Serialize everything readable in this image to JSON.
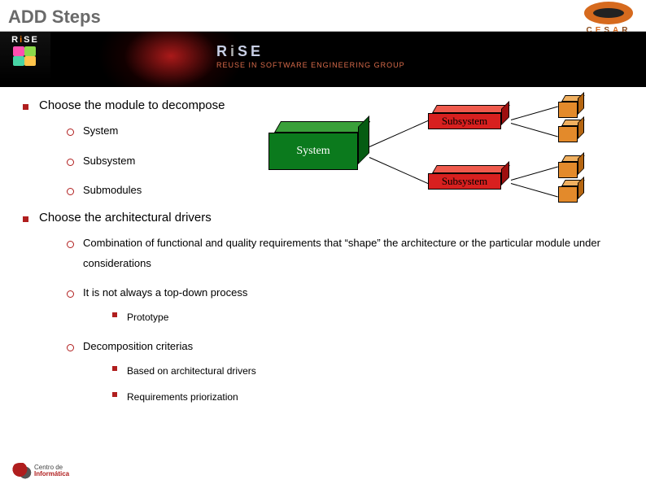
{
  "title": "ADD Steps",
  "brand": {
    "rise": "RiSE",
    "band_heading": "RiSE",
    "band_tagline": "REUSE IN SOFTWARE ENGINEERING GROUP",
    "right_logo": "CESAR"
  },
  "bullets": [
    {
      "text": "Choose the module to decompose",
      "children": [
        {
          "text": "System"
        },
        {
          "text": "Subsystem"
        },
        {
          "text": "Submodules"
        }
      ]
    },
    {
      "text": "Choose the architectural drivers",
      "children": [
        {
          "text": "Combination of functional and quality requirements that “shape” the architecture or the particular module under considerations"
        },
        {
          "text": "It is not always a top-down process",
          "children": [
            {
              "text": "Prototype"
            }
          ]
        },
        {
          "text": "Decomposition criterias",
          "children": [
            {
              "text": "Based on architectural drivers"
            },
            {
              "text": "Requirements priorization"
            }
          ]
        }
      ]
    }
  ],
  "diagram": {
    "system_label": "System",
    "subsystem_label_top": "Subsystem",
    "subsystem_label_bottom": "Subsystem"
  },
  "footer": {
    "line1": "Centro de",
    "line2": "Informática"
  }
}
